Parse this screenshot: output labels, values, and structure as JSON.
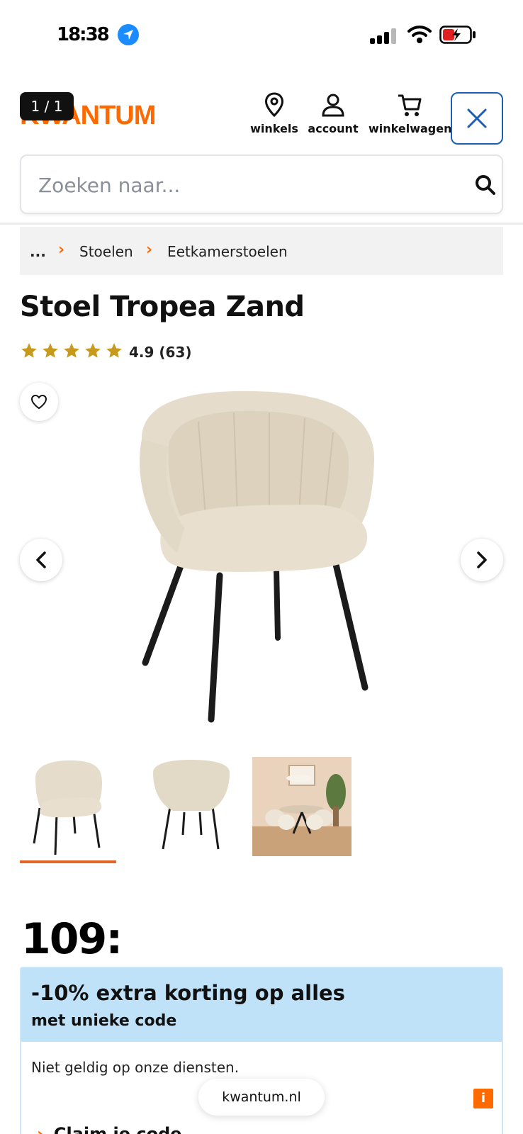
{
  "status_bar": {
    "time": "18:38",
    "icons": [
      "location-arrow-icon",
      "signal-icon",
      "wifi-icon",
      "battery-charging-icon"
    ]
  },
  "header": {
    "logo": "KWANTUM",
    "page_counter": "1 / 1",
    "nav": [
      {
        "label": "winkels",
        "icon": "location-pin-icon"
      },
      {
        "label": "account",
        "icon": "user-icon"
      },
      {
        "label": "winkelwagen",
        "icon": "cart-icon"
      }
    ],
    "close_icon": "close-icon"
  },
  "search": {
    "placeholder": "Zoeken naar...",
    "value": ""
  },
  "breadcrumb": {
    "items": [
      "...",
      "Stoelen",
      "Eetkamerstoelen"
    ]
  },
  "product": {
    "title": "Stoel Tropea Zand",
    "rating": 4.9,
    "stars": 5,
    "rating_label": "4.9 (63)",
    "review_count": 63,
    "price": "109:"
  },
  "gallery": {
    "thumbnails": 3,
    "active_thumbnail": 1
  },
  "promo": {
    "title": "-10% extra korting op alles",
    "subtitle": "met unieke code",
    "note": "Niet geldig op onze diensten.",
    "info_badge": "i",
    "claim_label": "Claim je code"
  },
  "browser": {
    "url": "kwantum.nl"
  },
  "colors": {
    "brand_orange": "#ff6a00",
    "promo_blue": "#bfe2f8",
    "close_border": "#1d5fb4",
    "star_gold": "#c79a1d"
  }
}
